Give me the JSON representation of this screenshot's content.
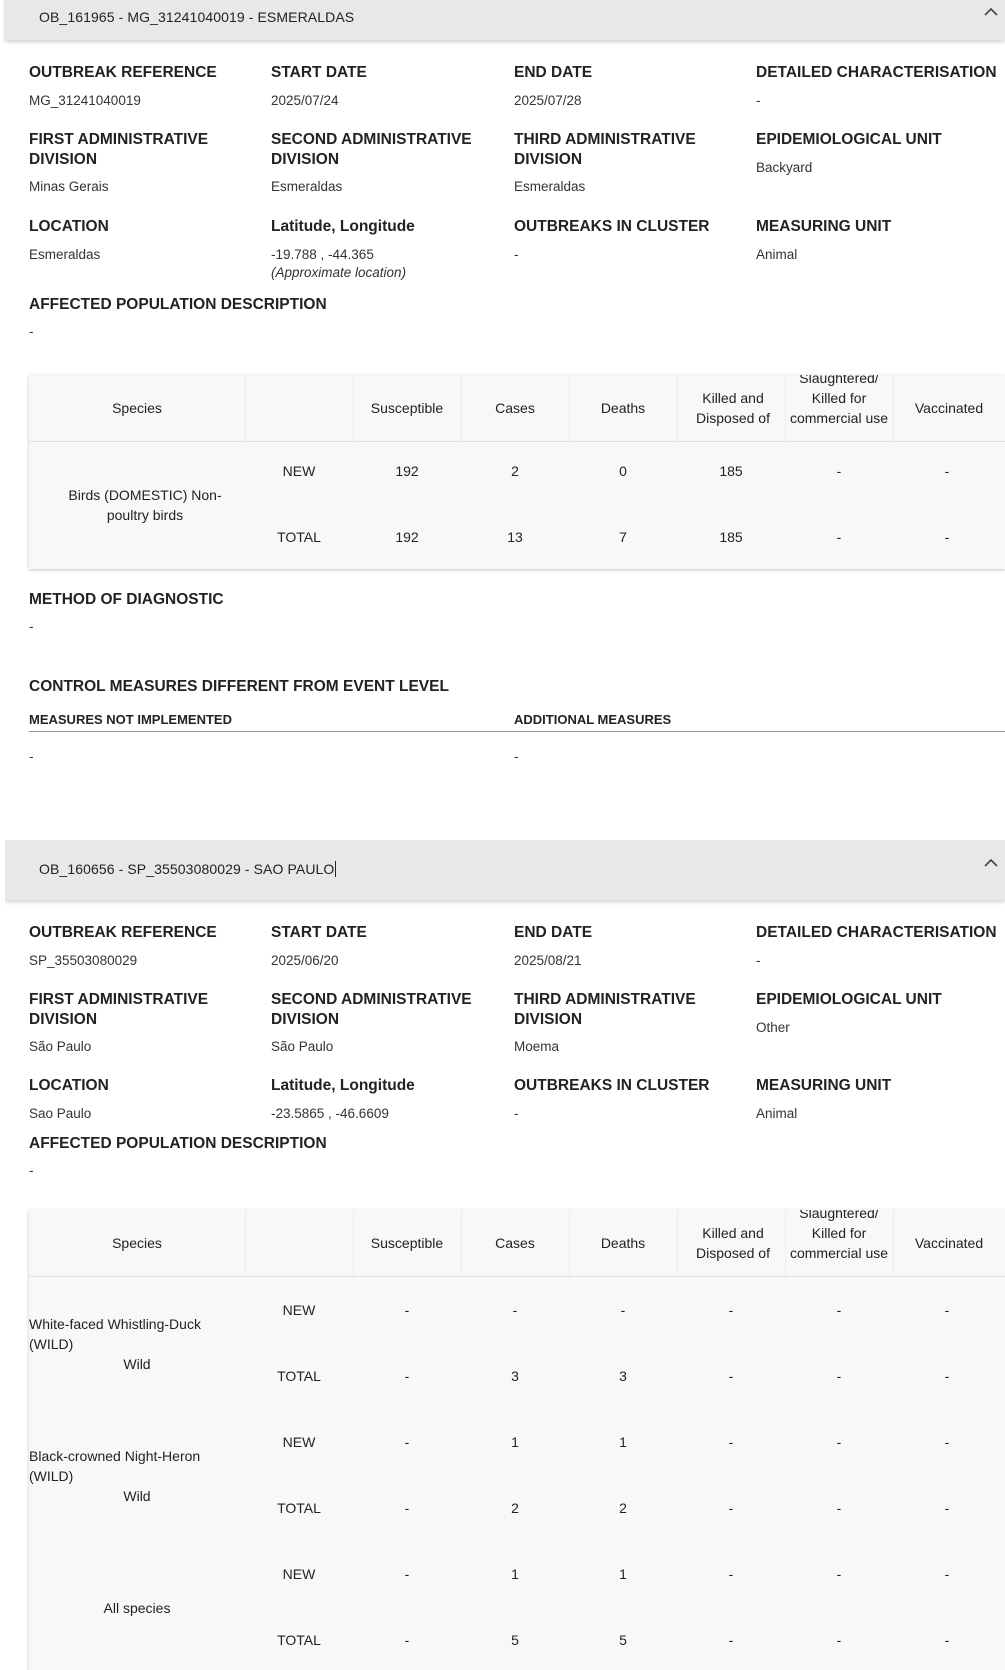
{
  "outbreaks": [
    {
      "header": "OB_161965 - MG_31241040019 - ESMERALDAS",
      "fields": [
        {
          "label": "OUTBREAK REFERENCE",
          "value": "MG_31241040019"
        },
        {
          "label": "START DATE",
          "value": "2025/07/24"
        },
        {
          "label": "END DATE",
          "value": "2025/07/28"
        },
        {
          "label": "DETAILED CHARACTERISATION",
          "value": "-"
        },
        {
          "label": "FIRST ADMINISTRATIVE DIVISION",
          "value": "Minas Gerais"
        },
        {
          "label": "SECOND ADMINISTRATIVE DIVISION",
          "value": "Esmeraldas"
        },
        {
          "label": "THIRD ADMINISTRATIVE DIVISION",
          "value": "Esmeraldas"
        },
        {
          "label": "EPIDEMIOLOGICAL UNIT",
          "value": "Backyard"
        },
        {
          "label": "LOCATION",
          "value": "Esmeraldas"
        },
        {
          "label": "Latitude, Longitude",
          "value": "-19.788 , -44.365",
          "note": "(Approximate location)"
        },
        {
          "label": "OUTBREAKS IN CLUSTER",
          "value": "-"
        },
        {
          "label": "MEASURING UNIT",
          "value": "Animal"
        }
      ],
      "affected_label": "AFFECTED POPULATION DESCRIPTION",
      "affected_value": "-",
      "table": {
        "headers": [
          "Species",
          "Susceptible",
          "Cases",
          "Deaths",
          "Killed and Disposed of",
          "Slaughtered/ Killed for commercial use",
          "Vaccinated"
        ],
        "groups": [
          {
            "species": "Birds (DOMESTIC) Non-poultry birds",
            "rows": [
              {
                "label": "NEW",
                "values": [
                  "192",
                  "2",
                  "0",
                  "185",
                  "-",
                  "-"
                ]
              },
              {
                "label": "TOTAL",
                "values": [
                  "192",
                  "13",
                  "7",
                  "185",
                  "-",
                  "-"
                ]
              }
            ]
          }
        ]
      },
      "diagnostic_label": "METHOD OF DIAGNOSTIC",
      "diagnostic_value": "-",
      "control_label": "CONTROL MEASURES DIFFERENT FROM EVENT LEVEL",
      "not_implemented_label": "MEASURES NOT IMPLEMENTED",
      "not_implemented_value": "-",
      "additional_label": "ADDITIONAL MEASURES",
      "additional_value": "-"
    },
    {
      "header": "OB_160656 - SP_35503080029 - SAO PAULO",
      "fields": [
        {
          "label": "OUTBREAK REFERENCE",
          "value": "SP_35503080029"
        },
        {
          "label": "START DATE",
          "value": "2025/06/20"
        },
        {
          "label": "END DATE",
          "value": "2025/08/21"
        },
        {
          "label": "DETAILED CHARACTERISATION",
          "value": "-"
        },
        {
          "label": "FIRST ADMINISTRATIVE DIVISION",
          "value": "São Paulo"
        },
        {
          "label": "SECOND ADMINISTRATIVE DIVISION",
          "value": "São Paulo"
        },
        {
          "label": "THIRD ADMINISTRATIVE DIVISION",
          "value": "Moema"
        },
        {
          "label": "EPIDEMIOLOGICAL UNIT",
          "value": "Other"
        },
        {
          "label": "LOCATION",
          "value": "Sao Paulo"
        },
        {
          "label": "Latitude, Longitude",
          "value": "-23.5865 , -46.6609"
        },
        {
          "label": "OUTBREAKS IN CLUSTER",
          "value": "-"
        },
        {
          "label": "MEASURING UNIT",
          "value": "Animal"
        }
      ],
      "affected_label": "AFFECTED POPULATION DESCRIPTION",
      "affected_value": "-",
      "table": {
        "headers": [
          "Species",
          "Susceptible",
          "Cases",
          "Deaths",
          "Killed and Disposed of",
          "Slaughtered/ Killed for commercial use",
          "Vaccinated"
        ],
        "groups": [
          {
            "species": "White-faced Whistling-Duck (WILD)",
            "sub": "Wild",
            "rows": [
              {
                "label": "NEW",
                "values": [
                  "-",
                  "-",
                  "-",
                  "-",
                  "-",
                  "-"
                ]
              },
              {
                "label": "TOTAL",
                "values": [
                  "-",
                  "3",
                  "3",
                  "-",
                  "-",
                  "-"
                ]
              }
            ]
          },
          {
            "species": "Black-crowned Night-Heron (WILD)",
            "sub": "Wild",
            "rows": [
              {
                "label": "NEW",
                "values": [
                  "-",
                  "1",
                  "1",
                  "-",
                  "-",
                  "-"
                ]
              },
              {
                "label": "TOTAL",
                "values": [
                  "-",
                  "2",
                  "2",
                  "-",
                  "-",
                  "-"
                ]
              }
            ]
          },
          {
            "species": "All species",
            "rows": [
              {
                "label": "NEW",
                "values": [
                  "-",
                  "1",
                  "1",
                  "-",
                  "-",
                  "-"
                ]
              },
              {
                "label": "TOTAL",
                "values": [
                  "-",
                  "5",
                  "5",
                  "-",
                  "-",
                  "-"
                ]
              }
            ]
          }
        ]
      }
    }
  ],
  "icons": {
    "collapse": "chevron-up-icon"
  }
}
